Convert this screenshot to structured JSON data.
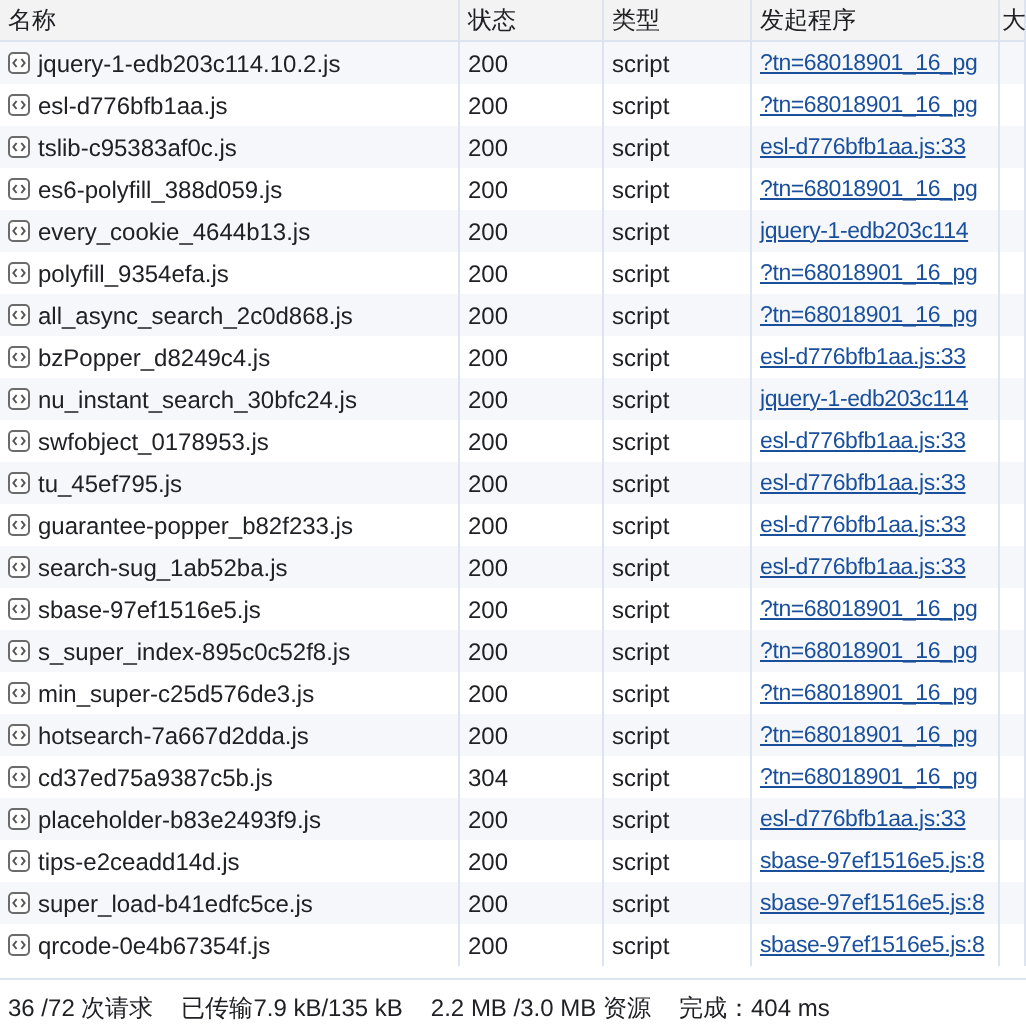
{
  "table": {
    "columns": [
      "名称",
      "状态",
      "类型",
      "发起程序",
      "大"
    ],
    "rows": [
      {
        "name": "jquery-1-edb203c114.10.2.js",
        "status": "200",
        "type": "script",
        "initiator": "?tn=68018901_16_pg"
      },
      {
        "name": "esl-d776bfb1aa.js",
        "status": "200",
        "type": "script",
        "initiator": "?tn=68018901_16_pg"
      },
      {
        "name": "tslib-c95383af0c.js",
        "status": "200",
        "type": "script",
        "initiator": "esl-d776bfb1aa.js:33"
      },
      {
        "name": "es6-polyfill_388d059.js",
        "status": "200",
        "type": "script",
        "initiator": "?tn=68018901_16_pg"
      },
      {
        "name": "every_cookie_4644b13.js",
        "status": "200",
        "type": "script",
        "initiator": "jquery-1-edb203c114"
      },
      {
        "name": "polyfill_9354efa.js",
        "status": "200",
        "type": "script",
        "initiator": "?tn=68018901_16_pg"
      },
      {
        "name": "all_async_search_2c0d868.js",
        "status": "200",
        "type": "script",
        "initiator": "?tn=68018901_16_pg"
      },
      {
        "name": "bzPopper_d8249c4.js",
        "status": "200",
        "type": "script",
        "initiator": "esl-d776bfb1aa.js:33"
      },
      {
        "name": "nu_instant_search_30bfc24.js",
        "status": "200",
        "type": "script",
        "initiator": "jquery-1-edb203c114"
      },
      {
        "name": "swfobject_0178953.js",
        "status": "200",
        "type": "script",
        "initiator": "esl-d776bfb1aa.js:33"
      },
      {
        "name": "tu_45ef795.js",
        "status": "200",
        "type": "script",
        "initiator": "esl-d776bfb1aa.js:33"
      },
      {
        "name": "guarantee-popper_b82f233.js",
        "status": "200",
        "type": "script",
        "initiator": "esl-d776bfb1aa.js:33"
      },
      {
        "name": "search-sug_1ab52ba.js",
        "status": "200",
        "type": "script",
        "initiator": "esl-d776bfb1aa.js:33"
      },
      {
        "name": "sbase-97ef1516e5.js",
        "status": "200",
        "type": "script",
        "initiator": "?tn=68018901_16_pg"
      },
      {
        "name": "s_super_index-895c0c52f8.js",
        "status": "200",
        "type": "script",
        "initiator": "?tn=68018901_16_pg"
      },
      {
        "name": "min_super-c25d576de3.js",
        "status": "200",
        "type": "script",
        "initiator": "?tn=68018901_16_pg"
      },
      {
        "name": "hotsearch-7a667d2dda.js",
        "status": "200",
        "type": "script",
        "initiator": "?tn=68018901_16_pg"
      },
      {
        "name": "cd37ed75a9387c5b.js",
        "status": "304",
        "type": "script",
        "initiator": "?tn=68018901_16_pg"
      },
      {
        "name": "placeholder-b83e2493f9.js",
        "status": "200",
        "type": "script",
        "initiator": "esl-d776bfb1aa.js:33"
      },
      {
        "name": "tips-e2ceadd14d.js",
        "status": "200",
        "type": "script",
        "initiator": "sbase-97ef1516e5.js:8"
      },
      {
        "name": "super_load-b41edfc5ce.js",
        "status": "200",
        "type": "script",
        "initiator": "sbase-97ef1516e5.js:8"
      },
      {
        "name": "qrcode-0e4b67354f.js",
        "status": "200",
        "type": "script",
        "initiator": "sbase-97ef1516e5.js:8"
      }
    ]
  },
  "status_bar": [
    "36 /72 次请求",
    "已传输7.9 kB/135 kB",
    "2.2 MB /3.0 MB 资源",
    "完成：404 ms"
  ]
}
